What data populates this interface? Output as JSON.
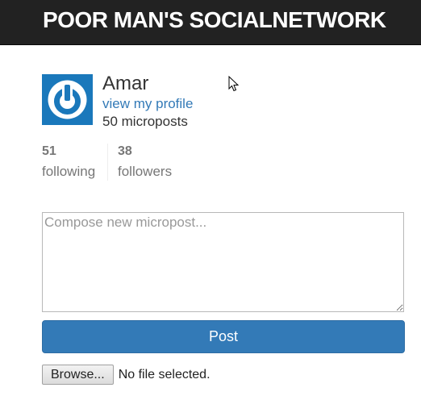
{
  "header": {
    "brand": "POOR MAN'S SOCIALNETWORK"
  },
  "user": {
    "name": "Amar",
    "profile_link": "view my profile",
    "micropost_count": "50 microposts"
  },
  "stats": {
    "following": {
      "count": "51",
      "label": "following"
    },
    "followers": {
      "count": "38",
      "label": "followers"
    }
  },
  "compose": {
    "placeholder": "Compose new micropost...",
    "value": ""
  },
  "post_button": {
    "label": "Post"
  },
  "file_input": {
    "browse_label": "Browse...",
    "status": "No file selected."
  },
  "colors": {
    "navbar": "#222222",
    "primary": "#337ab7",
    "gravatar_bg": "#1a78bb",
    "muted": "#777777"
  },
  "icons": {
    "gravatar": "power-symbol-icon",
    "cursor": "mouse-pointer-icon"
  }
}
